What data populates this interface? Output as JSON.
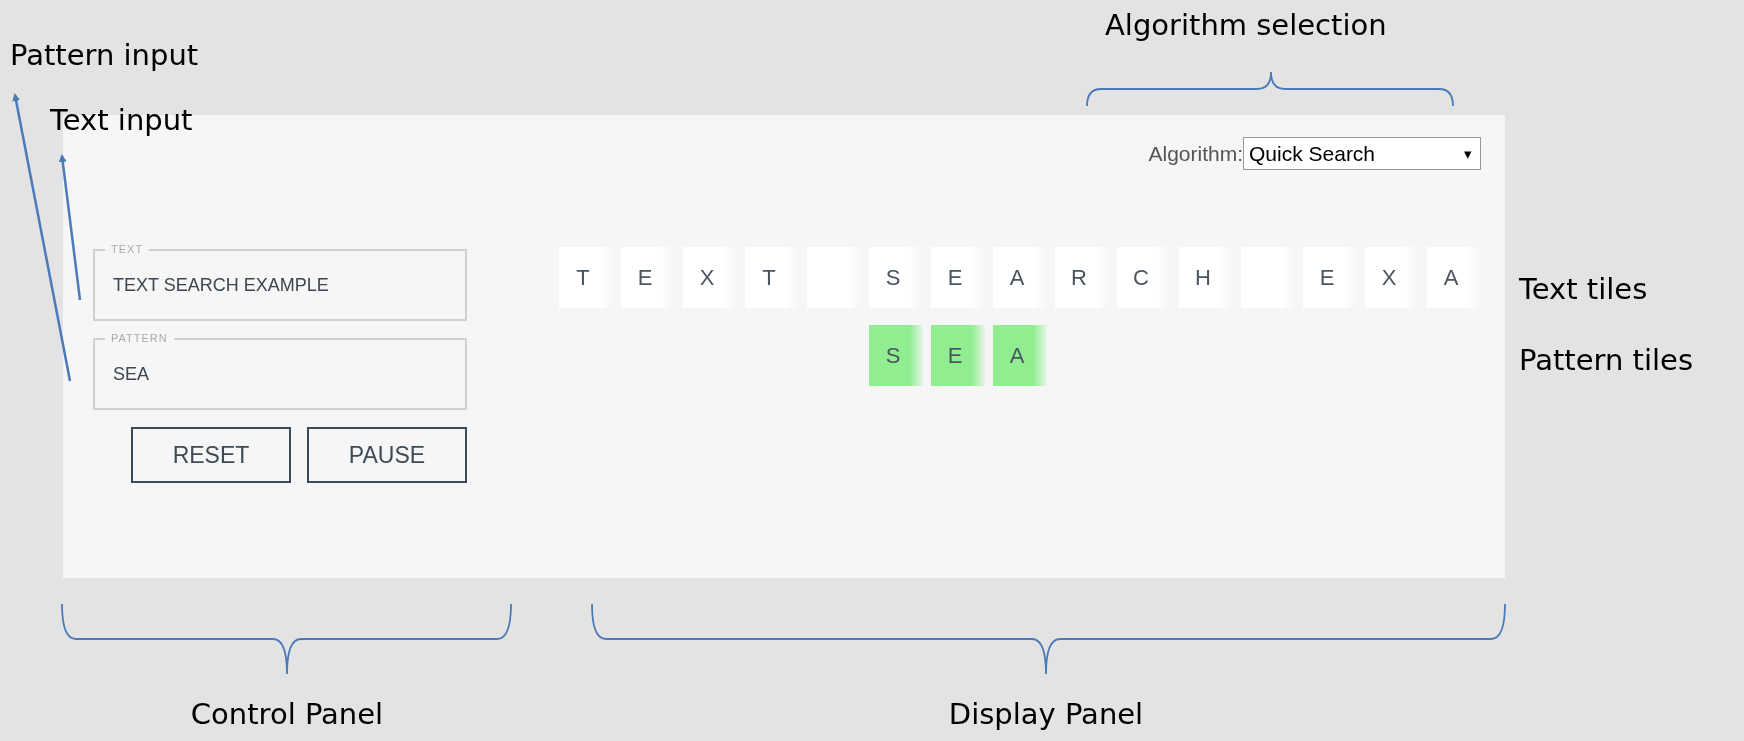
{
  "annotations": {
    "algorithm_selection": "Algorithm selection",
    "pattern_input": "Pattern input",
    "text_input": "Text input",
    "text_tiles": "Text tiles",
    "pattern_tiles": "Pattern tiles",
    "control_panel": "Control Panel",
    "display_panel": "Display Panel"
  },
  "algorithm": {
    "label": "Algorithm:",
    "value": "Quick Search",
    "arrow": "▾"
  },
  "fields": [
    {
      "legend": "TEXT",
      "value": "TEXT SEARCH EXAMPLE"
    },
    {
      "legend": "PATTERN",
      "value": "SEA"
    }
  ],
  "buttons": [
    "RESET",
    "PAUSE"
  ],
  "text_tiles": [
    {
      "kind": "letter",
      "char": "T"
    },
    {
      "kind": "letter",
      "char": "E"
    },
    {
      "kind": "letter",
      "char": "X"
    },
    {
      "kind": "letter",
      "char": "T"
    },
    {
      "kind": "blank"
    },
    {
      "kind": "letter",
      "char": "S"
    },
    {
      "kind": "letter",
      "char": "E"
    },
    {
      "kind": "letter",
      "char": "A"
    },
    {
      "kind": "letter",
      "char": "R"
    },
    {
      "kind": "letter",
      "char": "C"
    },
    {
      "kind": "letter",
      "char": "H"
    },
    {
      "kind": "blank"
    },
    {
      "kind": "letter",
      "char": "E"
    },
    {
      "kind": "letter",
      "char": "X"
    },
    {
      "kind": "letter",
      "char": "A"
    }
  ],
  "pattern_tiles": [
    {
      "char": "S",
      "matched": true
    },
    {
      "char": "E",
      "matched": true
    },
    {
      "char": "A",
      "matched": true
    }
  ]
}
